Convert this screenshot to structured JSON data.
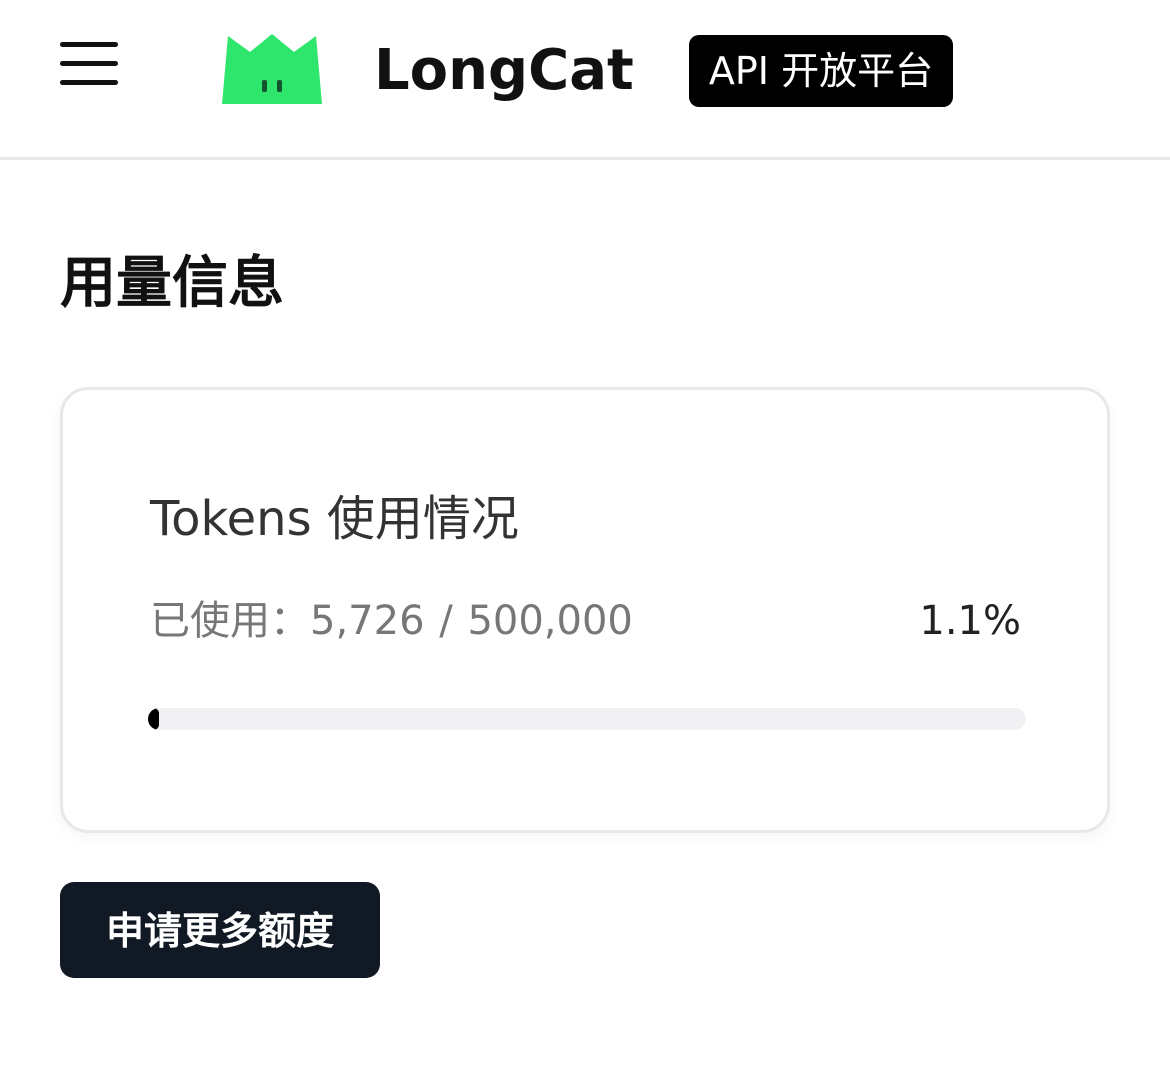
{
  "header": {
    "menu_icon": "hamburger-menu-icon",
    "logo_icon": "longcat-logo-icon",
    "brand_name": "LongCat",
    "badge_label": "API 开放平台",
    "logo_color": "#2ee66b"
  },
  "usage": {
    "section_title": "用量信息",
    "card_title": "Tokens 使用情况",
    "used_label": "已使用：",
    "used_value": "5,726",
    "separator": "/",
    "total_value": "500,000",
    "percent_text": "1.1%",
    "progress_fraction": 0.011
  },
  "actions": {
    "request_more_label": "申请更多额度"
  }
}
